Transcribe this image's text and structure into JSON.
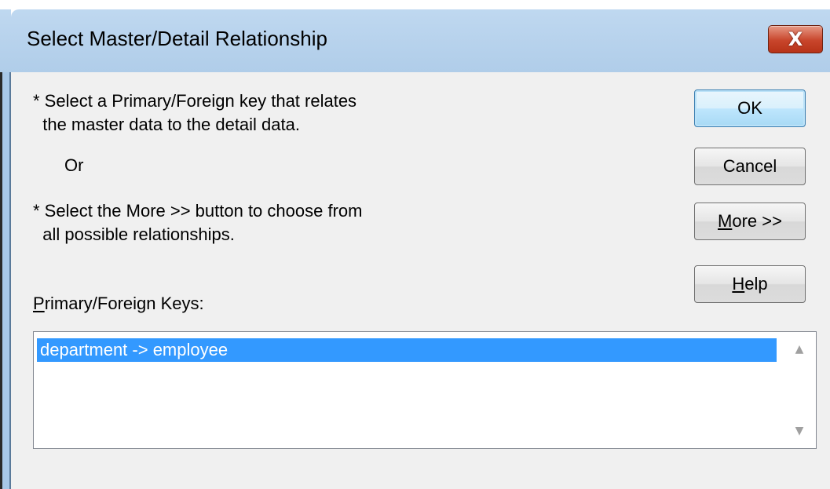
{
  "window": {
    "title": "Select Master/Detail Relationship",
    "close_glyph": "X"
  },
  "instructions": {
    "line1a": "* Select a Primary/Foreign key that relates",
    "line1b": "  the master data to the detail data.",
    "or": "Or",
    "line2a": "* Select the More >> button to choose from",
    "line2b": "  all possible relationships."
  },
  "list_label": {
    "mnemonic": "P",
    "rest": "rimary/Foreign Keys:"
  },
  "keys_list": {
    "items": [
      "department -> employee"
    ],
    "selected_index": 0
  },
  "buttons": {
    "ok": "OK",
    "cancel": "Cancel",
    "more_mnemonic": "M",
    "more_rest": "ore >>",
    "help_mnemonic": "H",
    "help_rest": "elp"
  },
  "colors": {
    "selection": "#3399ff",
    "titlebar": "#bfd8f0",
    "close": "#c8452b"
  }
}
